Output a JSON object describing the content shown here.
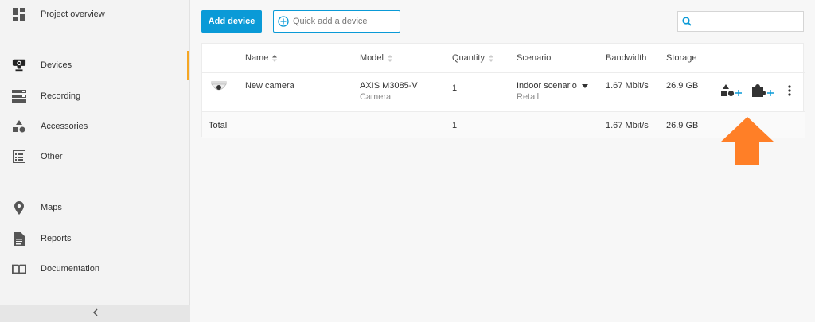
{
  "sidebar": {
    "items": [
      {
        "label": "Project overview",
        "icon": "dashboard-icon"
      },
      {
        "label": "Devices",
        "icon": "camera-icon"
      },
      {
        "label": "Recording",
        "icon": "recorder-icon"
      },
      {
        "label": "Accessories",
        "icon": "shapes-icon"
      },
      {
        "label": "Other",
        "icon": "list-icon"
      },
      {
        "label": "Maps",
        "icon": "map-pin-icon"
      },
      {
        "label": "Reports",
        "icon": "report-icon"
      },
      {
        "label": "Documentation",
        "icon": "book-icon"
      }
    ],
    "active": "Devices",
    "accent_color": "#f5a623"
  },
  "toolbar": {
    "add_device_label": "Add device",
    "quick_add_placeholder": "Quick add a device",
    "search_placeholder": "",
    "button_color": "#0a9ad7"
  },
  "table": {
    "columns": {
      "name": "Name",
      "model": "Model",
      "quantity": "Quantity",
      "scenario": "Scenario",
      "bandwidth": "Bandwidth",
      "storage": "Storage"
    },
    "rows": [
      {
        "name": "New camera",
        "model": "AXIS M3085-V",
        "model_type": "Camera",
        "quantity": "1",
        "scenario": "Indoor scenario",
        "scenario_sub": "Retail",
        "bandwidth": "1.67 Mbit/s",
        "storage": "26.9 GB"
      }
    ],
    "total": {
      "label": "Total",
      "quantity": "1",
      "bandwidth": "1.67 Mbit/s",
      "storage": "26.9 GB"
    }
  },
  "annotation": {
    "arrow_color": "#ff7f27"
  }
}
